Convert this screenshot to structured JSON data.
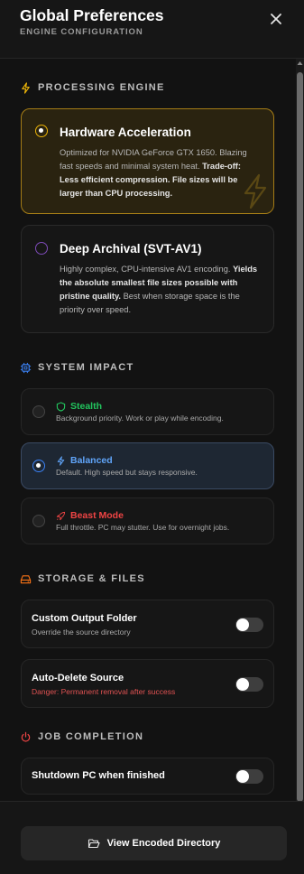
{
  "header": {
    "title": "Global Preferences",
    "subtitle": "ENGINE CONFIGURATION"
  },
  "sections": {
    "processing": "PROCESSING ENGINE",
    "impact": "SYSTEM IMPACT",
    "storage": "STORAGE & FILES",
    "completion": "JOB COMPLETION"
  },
  "engines": [
    {
      "title": "Hardware Acceleration",
      "desc_plain": "Optimized for NVIDIA GeForce GTX 1650. Blazing fast speeds and minimal system heat. ",
      "desc_bold": "Trade-off: Less efficient compression. File sizes will be larger than CPU processing.",
      "desc_after": "",
      "selected": true
    },
    {
      "title": "Deep Archival (SVT-AV1)",
      "desc_plain": "Highly complex, CPU-intensive AV1 encoding. ",
      "desc_bold": "Yields the absolute smallest file sizes possible with pristine quality.",
      "desc_after": " Best when storage space is the priority over speed.",
      "selected": false
    }
  ],
  "impact": [
    {
      "label": "Stealth",
      "desc": "Background priority. Work or play while encoding.",
      "color": "#22c55e",
      "icon": "shield-icon",
      "selected": false
    },
    {
      "label": "Balanced",
      "desc": "Default. High speed but stays responsive.",
      "color": "#60a5fa",
      "icon": "bolt-icon",
      "selected": true
    },
    {
      "label": "Beast Mode",
      "desc": "Full throttle. PC may stutter. Use for overnight jobs.",
      "color": "#ef4444",
      "icon": "rocket-icon",
      "selected": false
    }
  ],
  "storage": {
    "custom_output": {
      "label": "Custom Output Folder",
      "desc": "Override the source directory",
      "enabled": false
    },
    "auto_delete": {
      "label": "Auto-Delete Source",
      "desc": "Danger: Permanent removal after success",
      "enabled": false
    }
  },
  "completion": {
    "shutdown": {
      "label": "Shutdown PC when finished",
      "enabled": false
    }
  },
  "footer": {
    "button": "View Encoded Directory"
  },
  "colors": {
    "accent_gold": "#eab308",
    "accent_blue": "#3b82f6",
    "accent_orange": "#f97316",
    "accent_red": "#ef4444",
    "accent_purple": "#a855f7",
    "danger_text": "#e05252"
  }
}
